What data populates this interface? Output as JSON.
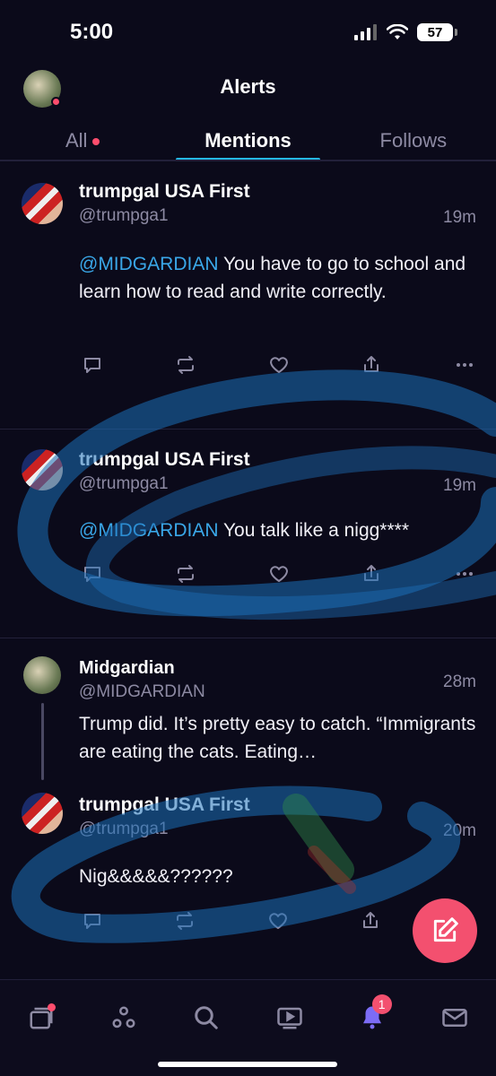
{
  "status_bar": {
    "time": "5:00",
    "battery": "57"
  },
  "header": {
    "title": "Alerts"
  },
  "tabs": [
    {
      "label": "All",
      "has_dot": true
    },
    {
      "label": "Mentions",
      "active": true
    },
    {
      "label": "Follows"
    }
  ],
  "posts": [
    {
      "author": "trumpgal USA First",
      "handle": "@trumpga1",
      "time": "19m",
      "mention": "@MIDGARDIAN",
      "text": " You have to go to school and learn how to read and write correctly."
    },
    {
      "author": "trumpgal USA First",
      "handle": "@trumpga1",
      "time": "19m",
      "mention": "@MIDGARDIAN",
      "text": " You talk like a nigg****"
    },
    {
      "author": "Midgardian",
      "handle": "@MIDGARDIAN",
      "time": "28m",
      "text": "Trump did. It’s pretty easy to catch. “Immigrants are eating the cats. Eating…"
    },
    {
      "author": "trumpgal USA First",
      "handle": "@trumpga1",
      "time": "20m",
      "text": "Nig&&&&&??????"
    }
  ],
  "tabbar": {
    "notifications_badge": "1"
  },
  "colors": {
    "accent": "#25b8e8",
    "fab": "#f3506f",
    "background": "#0b0a1a"
  },
  "icons": {
    "actions": [
      "reply-icon",
      "repost-icon",
      "like-icon",
      "share-icon",
      "more-icon"
    ],
    "tabbar": [
      "feeds-icon",
      "communities-icon",
      "search-icon",
      "video-icon",
      "bell-icon",
      "mail-icon"
    ],
    "fab": "compose-icon"
  }
}
